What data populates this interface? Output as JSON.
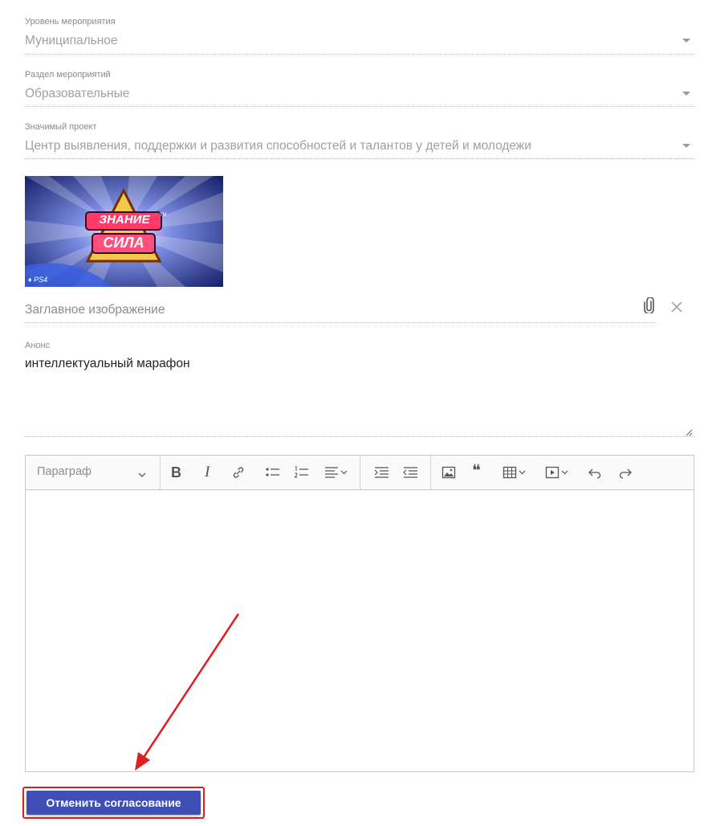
{
  "fields": {
    "event_level": {
      "label": "Уровень мероприятия",
      "value": "Муниципальное"
    },
    "event_section": {
      "label": "Раздел мероприятий",
      "value": "Образовательные"
    },
    "project": {
      "label": "Значимый проект",
      "value": "Центр выявления, поддержки и развития способностей и талантов у детей и молодежи"
    }
  },
  "cover": {
    "image_title_line1": "ЗНАНИЕ",
    "image_title_line2": "СИЛА",
    "image_badge": "PS4",
    "tm": "TM",
    "placeholder": "Заглавное изображение"
  },
  "announce": {
    "label": "Анонс",
    "text": "интеллектуальный марафон"
  },
  "editor": {
    "paragraph_label": "Параграф",
    "bold": "B",
    "italic": "I",
    "quote": "❝"
  },
  "colors": {
    "accent": "#3f4fb5",
    "annotation": "#e01e1e"
  },
  "actions": {
    "cancel_approval": "Отменить согласование"
  }
}
